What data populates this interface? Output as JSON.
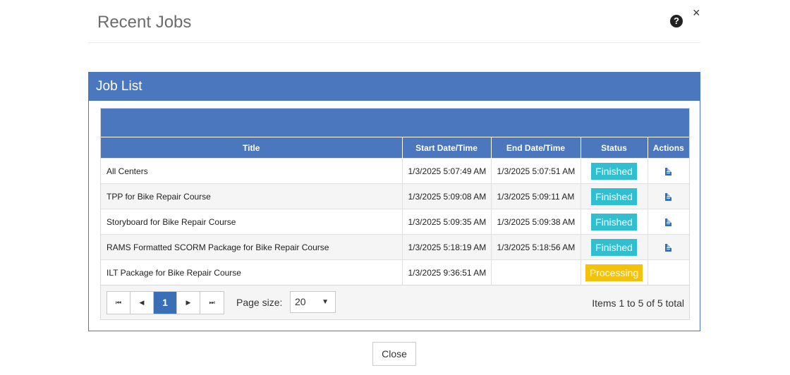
{
  "header": {
    "title": "Recent Jobs",
    "help_glyph": "?",
    "close_glyph": "×"
  },
  "panel": {
    "title": "Job List"
  },
  "grid": {
    "columns": [
      "Title",
      "Start Date/Time",
      "End Date/Time",
      "Status",
      "Actions"
    ],
    "rows": [
      {
        "title": "All Centers",
        "start": "1/3/2025 5:07:49 AM",
        "end": "1/3/2025 5:07:51 AM",
        "status": "Finished",
        "has_action": true
      },
      {
        "title": "TPP for Bike Repair Course",
        "start": "1/3/2025 5:09:08 AM",
        "end": "1/3/2025 5:09:11 AM",
        "status": "Finished",
        "has_action": true
      },
      {
        "title": "Storyboard for Bike Repair Course",
        "start": "1/3/2025 5:09:35 AM",
        "end": "1/3/2025 5:09:38 AM",
        "status": "Finished",
        "has_action": true
      },
      {
        "title": "RAMS Formatted SCORM Package for Bike Repair Course",
        "start": "1/3/2025 5:18:19 AM",
        "end": "1/3/2025 5:18:56 AM",
        "status": "Finished",
        "has_action": true
      },
      {
        "title": "ILT Package for Bike Repair Course",
        "start": "1/3/2025 9:36:51 AM",
        "end": "",
        "status": "Processing",
        "has_action": false
      }
    ],
    "status_colors": {
      "Finished": "#31bfd0",
      "Processing": "#f2c20c"
    }
  },
  "pager": {
    "first_glyph": "⏮",
    "prev_glyph": "◀",
    "current_page": "1",
    "next_glyph": "▶",
    "last_glyph": "⏭",
    "page_size_label": "Page size:",
    "page_size_value": "20",
    "info": "Items 1 to 5 of 5 total"
  },
  "footer": {
    "close_label": "Close"
  },
  "colors": {
    "accent": "#4a77be",
    "pager_active": "#3a6fb5"
  }
}
